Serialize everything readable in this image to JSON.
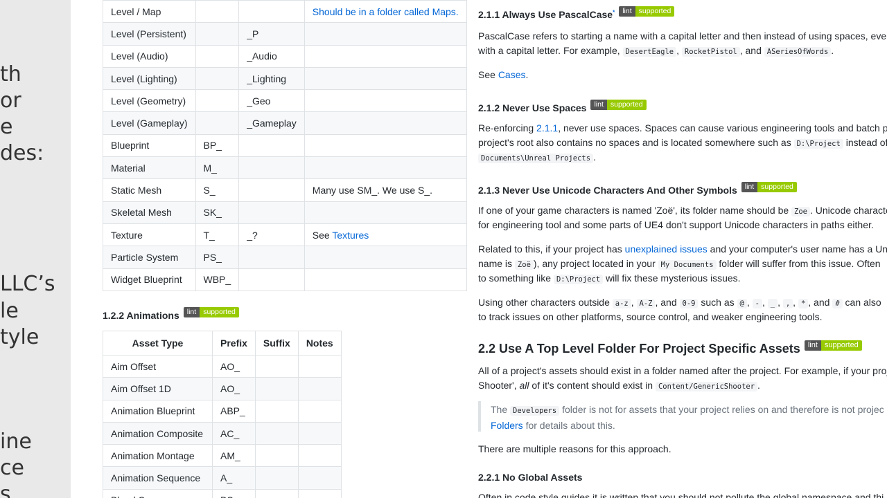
{
  "left_fragments": [
    "th",
    "or",
    "e",
    "des:",
    "LLC’s",
    "le",
    "tyle",
    "ine",
    "ce",
    "s"
  ],
  "table1": {
    "rows": [
      [
        "Level / Map",
        "",
        "",
        "Should be in a folder called Maps."
      ],
      [
        "Level (Persistent)",
        "",
        "_P",
        ""
      ],
      [
        "Level (Audio)",
        "",
        "_Audio",
        ""
      ],
      [
        "Level (Lighting)",
        "",
        "_Lighting",
        ""
      ],
      [
        "Level (Geometry)",
        "",
        "_Geo",
        ""
      ],
      [
        "Level (Gameplay)",
        "",
        "_Gameplay",
        ""
      ],
      [
        "Blueprint",
        "BP_",
        "",
        ""
      ],
      [
        "Material",
        "M_",
        "",
        ""
      ],
      [
        "Static Mesh",
        "S_",
        "",
        "Many use SM_. We use S_."
      ],
      [
        "Skeletal Mesh",
        "SK_",
        "",
        ""
      ],
      [
        "Texture",
        "T_",
        "_?",
        "See"
      ],
      [
        "Particle System",
        "PS_",
        "",
        ""
      ],
      [
        "Widget Blueprint",
        "WBP_",
        "",
        ""
      ]
    ],
    "texture_link": "Textures"
  },
  "animations": {
    "heading": "1.2.2 Animations",
    "headers": [
      "Asset Type",
      "Prefix",
      "Suffix",
      "Notes"
    ],
    "rows": [
      [
        "Aim Offset",
        "AO_",
        "",
        ""
      ],
      [
        "Aim Offset 1D",
        "AO_",
        "",
        ""
      ],
      [
        "Animation Blueprint",
        "ABP_",
        "",
        ""
      ],
      [
        "Animation Composite",
        "AC_",
        "",
        ""
      ],
      [
        "Animation Montage",
        "AM_",
        "",
        ""
      ],
      [
        "Animation Sequence",
        "A_",
        "",
        ""
      ],
      [
        "Blend Space",
        "BS_",
        "",
        ""
      ]
    ]
  },
  "badge": {
    "left": "lint",
    "right": "supported",
    "left_color": "#555555",
    "right_color": "#97ca00"
  },
  "link_color": "#0366d6",
  "sections": {
    "s211": {
      "heading": "2.1.1 Always Use PascalCase",
      "sup": "*",
      "p1a": "PascalCase refers to starting a name with a capital letter and then instead of using spaces, every",
      "p1b": "with a capital letter. For example,",
      "codes": [
        "DesertEagle",
        "RocketPistol",
        "ASeriesOfWords"
      ],
      "sep1": ",",
      "sep2": ", and",
      "end": ".",
      "see": "See",
      "see_link": "Cases",
      "dot": "."
    },
    "s212": {
      "heading": "2.1.2 Never Use Spaces",
      "p1a_pre": "Re-enforcing",
      "p1a_link": "2.1.1",
      "p1a_post": ", never use spaces. Spaces can cause various engineering tools and batch proc",
      "p1b_pre": "project's root also contains no spaces and is located somewhere such as",
      "code1": "D:\\Project",
      "p1b_post": "instead of",
      "code2": "Documents\\Unreal Projects",
      "end": "."
    },
    "s213": {
      "heading": "2.1.3 Never Use Unicode Characters And Other Symbols",
      "p1a_pre": "If one of your game characters is named 'Zoë', its folder name should be",
      "p1a_code": "Zoe",
      "p1a_post": ". Unicode characte",
      "p1b": "for engineering tool and some parts of UE4 don't support Unicode characters in paths either.",
      "p2a_pre": "Related to this, if your project has",
      "p2a_link": "unexplained issues",
      "p2a_post": "and your computer's user name has a Unic",
      "p2b_pre": "name is",
      "p2b_code1": "Zoë",
      "p2b_mid": "), any project located in your",
      "p2b_code2": "My Documents",
      "p2b_post": "folder will suffer from this issue. Often",
      "p2c_pre": "to something like",
      "p2c_code": "D:\\Project",
      "p2c_post": "will fix these mysterious issues.",
      "p3a_pre": "Using other characters outside",
      "p3a_codes": [
        "a-z",
        "A-Z",
        "0-9",
        "@",
        "-",
        "_",
        ",",
        "*",
        "#"
      ],
      "comma": ",",
      "and": ", and",
      "such_as": "such as",
      "and2": ", and",
      "can_also": "can also",
      "p3b": "to track issues on other platforms, source control, and weaker engineering tools."
    },
    "s22": {
      "heading": "2.2 Use A Top Level Folder For Project Specific Assets",
      "p1a": "All of a project's assets should exist in a folder named after the project. For example, if your proj",
      "p1b_pre": "Shooter',",
      "p1b_em": "all",
      "p1b_mid": "of it's content should exist in",
      "p1b_code": "Content/GenericShooter",
      "p1b_end": ".",
      "q1_pre": "The",
      "q1_code": "Developers",
      "q1_post": "folder is not for assets that your project relies on and therefore is not projec",
      "q2_link": "Folders",
      "q2_post": "for details about this.",
      "p2": "There are multiple reasons for this approach."
    },
    "s221": {
      "heading": "2.2.1 No Global Assets",
      "p1": "Often in code style guides it is written that you should not pollute the global namespace and thi"
    }
  }
}
